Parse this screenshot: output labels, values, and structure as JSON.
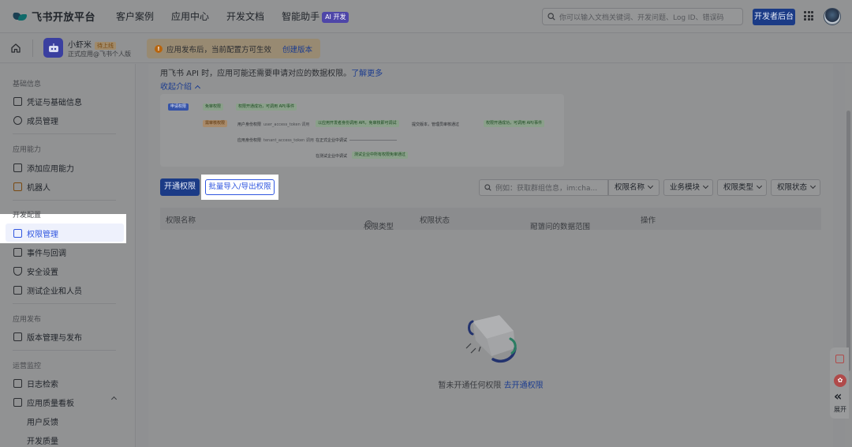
{
  "topnav": {
    "brand": "飞书开放平台",
    "links": [
      "客户案例",
      "应用中心",
      "开发文档",
      "智能助手"
    ],
    "ai_badge": "AI 开发",
    "search_placeholder": "你可以输入文档关键词、开发问题、Log ID、错误码",
    "dev_console": "开发者后台"
  },
  "app": {
    "name": "小虾米",
    "status": "待上线",
    "subtitle": "正式应用@飞书个人版"
  },
  "notice": {
    "text": "应用发布后，当前配置方可生效",
    "action": "创建版本"
  },
  "sidebar": {
    "groups": {
      "basic": "基础信息",
      "capability": "应用能力",
      "dev_config": "开发配置",
      "release": "应用发布",
      "ops": "运营监控"
    },
    "items": {
      "credentials": "凭证与基础信息",
      "members": "成员管理",
      "add_capability": "添加应用能力",
      "bot": "机器人",
      "permissions": "权限管理",
      "events": "事件与回调",
      "security": "安全设置",
      "test_org": "测试企业和人员",
      "version": "版本管理与发布",
      "logs": "日志检索",
      "quality": "应用质量看板",
      "feedback": "用户反馈",
      "dev_quality": "开发质量"
    }
  },
  "main": {
    "intro_line1": "用飞书 API 时，应用可能还需要申请对应的数据权限。",
    "intro_link": "了解更多",
    "collapse": "收起介绍",
    "flow": {
      "apply": "申请权限",
      "free": "免审权限",
      "free_result": "权限开通成功，可调用 API/事件",
      "review": "需审核权限",
      "user_perm": "用户身份权限",
      "user_token": "user_access_token 调用",
      "user_step": "以应用开发者身份调用 API，免审核即可调试",
      "submit": "提交版本，管理员审核通过",
      "success": "权限开通成功，可调用 API/事件",
      "app_perm": "应用身份权限",
      "tenant_token": "tenant_access_token 调用",
      "formal": "在正式企业中调试",
      "test": "在测试企业中调试",
      "test_step": "测试企业中所有权限免审通过"
    },
    "btn_open": "开通权限",
    "btn_batch": "批量导入/导出权限",
    "filter_placeholder": "例如：获取群组信息，im:cha...",
    "filters": [
      "权限名称",
      "业务模块",
      "权限类型",
      "权限状态"
    ],
    "columns": {
      "name": "权限名称",
      "type": "权限类型",
      "status": "权限状态",
      "scope": "可访问的数据范围",
      "scope_tag": "配置",
      "ops": "操作"
    },
    "empty_text": "暂未开通任何权限",
    "empty_link": "去开通权限"
  },
  "float": {
    "expand": "展开"
  }
}
